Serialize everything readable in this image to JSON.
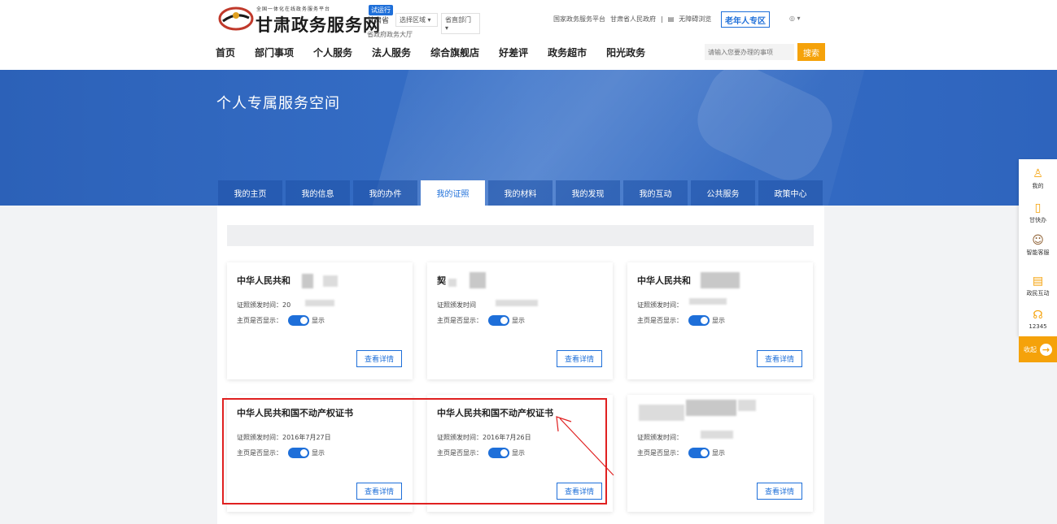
{
  "header": {
    "logo_sub": "全国一体化在线政务服务平台",
    "logo_main": "甘肃政务服务网",
    "trial_badge": "试运行",
    "region": "甘肃省",
    "select_area": "选择区域",
    "select_dept": "省直部门",
    "hall": "省政府政务大厅",
    "links": [
      "国家政务服务平台",
      "甘肃省人民政府",
      "|",
      "无障碍浏览"
    ],
    "elder_label": "老年人专区"
  },
  "nav": {
    "items": [
      "首页",
      "部门事项",
      "个人服务",
      "法人服务",
      "综合旗舰店",
      "好差评",
      "政务超市",
      "阳光政务"
    ],
    "search_placeholder": "请输入您要办理的事项",
    "search_label": "搜索"
  },
  "banner": {
    "title": "个人专属服务空间"
  },
  "tabs": {
    "items": [
      "我的主页",
      "我的信息",
      "我的办件",
      "我的证照",
      "我的材料",
      "我的发现",
      "我的互动",
      "公共服务",
      "政策中心"
    ],
    "active_index": 3
  },
  "cards": [
    {
      "title": "中华人民共和",
      "date_label": "证照颁发时间：",
      "date": "20",
      "show_label": "主页是否显示：",
      "toggle_label": "显示",
      "detail_label": "查看详情"
    },
    {
      "title": "契",
      "date_label": "证照颁发时间",
      "date": "",
      "show_label": "主页是否显示：",
      "toggle_label": "显示",
      "detail_label": "查看详情"
    },
    {
      "title": "中华人民共和",
      "date_label": "证照颁发时间：",
      "date": "",
      "show_label": "主页是否显示：",
      "toggle_label": "显示",
      "detail_label": "查看详情"
    },
    {
      "title": "中华人民共和国不动产权证书",
      "date_label": "证照颁发时间：",
      "date": "2016年7月27日",
      "show_label": "主页是否显示：",
      "toggle_label": "显示",
      "detail_label": "查看详情"
    },
    {
      "title": "中华人民共和国不动产权证书",
      "date_label": "证照颁发时间：",
      "date": "2016年7月26日",
      "show_label": "主页是否显示：",
      "toggle_label": "显示",
      "detail_label": "查看详情"
    },
    {
      "title": "",
      "date_label": "证照颁发时间：",
      "date": "",
      "show_label": "主页是否显示：",
      "toggle_label": "显示",
      "detail_label": "查看详情"
    }
  ],
  "right_bar": {
    "items": [
      {
        "label": "我的",
        "icon": "user-icon"
      },
      {
        "label": "甘快办",
        "icon": "phone-icon"
      },
      {
        "label": "智能客服",
        "icon": "robot-icon"
      },
      {
        "label": "政民互动",
        "icon": "chat-icon"
      },
      {
        "label": "12345",
        "icon": "headset-icon"
      }
    ],
    "collapse_label": "收起"
  },
  "colors": {
    "primary": "#1e6fd9",
    "accent": "#f5a20a",
    "banner": "#2f66be",
    "highlight": "#e02020"
  }
}
